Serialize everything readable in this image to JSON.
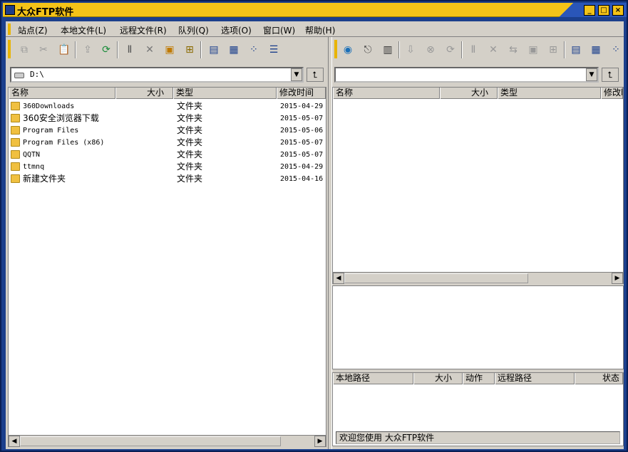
{
  "window": {
    "title": "大众FTP软件",
    "min": "_",
    "max": "□",
    "close": "×"
  },
  "menu": [
    "站点(Z)",
    "本地文件(L)",
    "远程文件(R)",
    "队列(Q)",
    "选项(O)",
    "窗口(W)",
    "帮助(H)"
  ],
  "local": {
    "path": "D:\\",
    "columns": [
      "名称",
      "大小",
      "类型",
      "修改时间"
    ],
    "rows": [
      {
        "name": "360Downloads",
        "type": "文件夹",
        "modified": "2015-04-29"
      },
      {
        "name": "360安全浏览器下载",
        "type": "文件夹",
        "modified": "2015-05-07"
      },
      {
        "name": "Program Files",
        "type": "文件夹",
        "modified": "2015-05-06"
      },
      {
        "name": "Program Files (x86)",
        "type": "文件夹",
        "modified": "2015-05-07"
      },
      {
        "name": "QQTN",
        "type": "文件夹",
        "modified": "2015-05-07"
      },
      {
        "name": "ttmnq",
        "type": "文件夹",
        "modified": "2015-04-29"
      },
      {
        "name": "新建文件夹",
        "type": "文件夹",
        "modified": "2015-04-16"
      }
    ]
  },
  "remote": {
    "path": "",
    "columns": [
      "名称",
      "大小",
      "类型",
      "修改时"
    ]
  },
  "queue": {
    "columns": [
      "本地路径",
      "大小",
      "动作",
      "远程路径",
      "状态"
    ]
  },
  "status": {
    "text": "欢迎您使用 大众FTP软件"
  },
  "icons": {
    "local_toolbar": [
      "copy-icon",
      "cut-icon",
      "paste-icon",
      "upload-icon",
      "refresh-icon",
      "rename-icon",
      "delete-icon",
      "new-folder-icon",
      "properties-icon",
      "large-icons-view-icon",
      "small-icons-view-icon",
      "list-view-icon",
      "details-view-icon"
    ],
    "remote_toolbar": [
      "connect-icon",
      "disconnect-icon",
      "site-manager-icon",
      "download-icon",
      "stop-icon",
      "refresh-icon",
      "rename-icon",
      "delete-icon",
      "move-icon",
      "new-folder-icon",
      "properties-icon",
      "large-icons-view-icon",
      "small-icons-view-icon",
      "list-view-icon"
    ]
  }
}
